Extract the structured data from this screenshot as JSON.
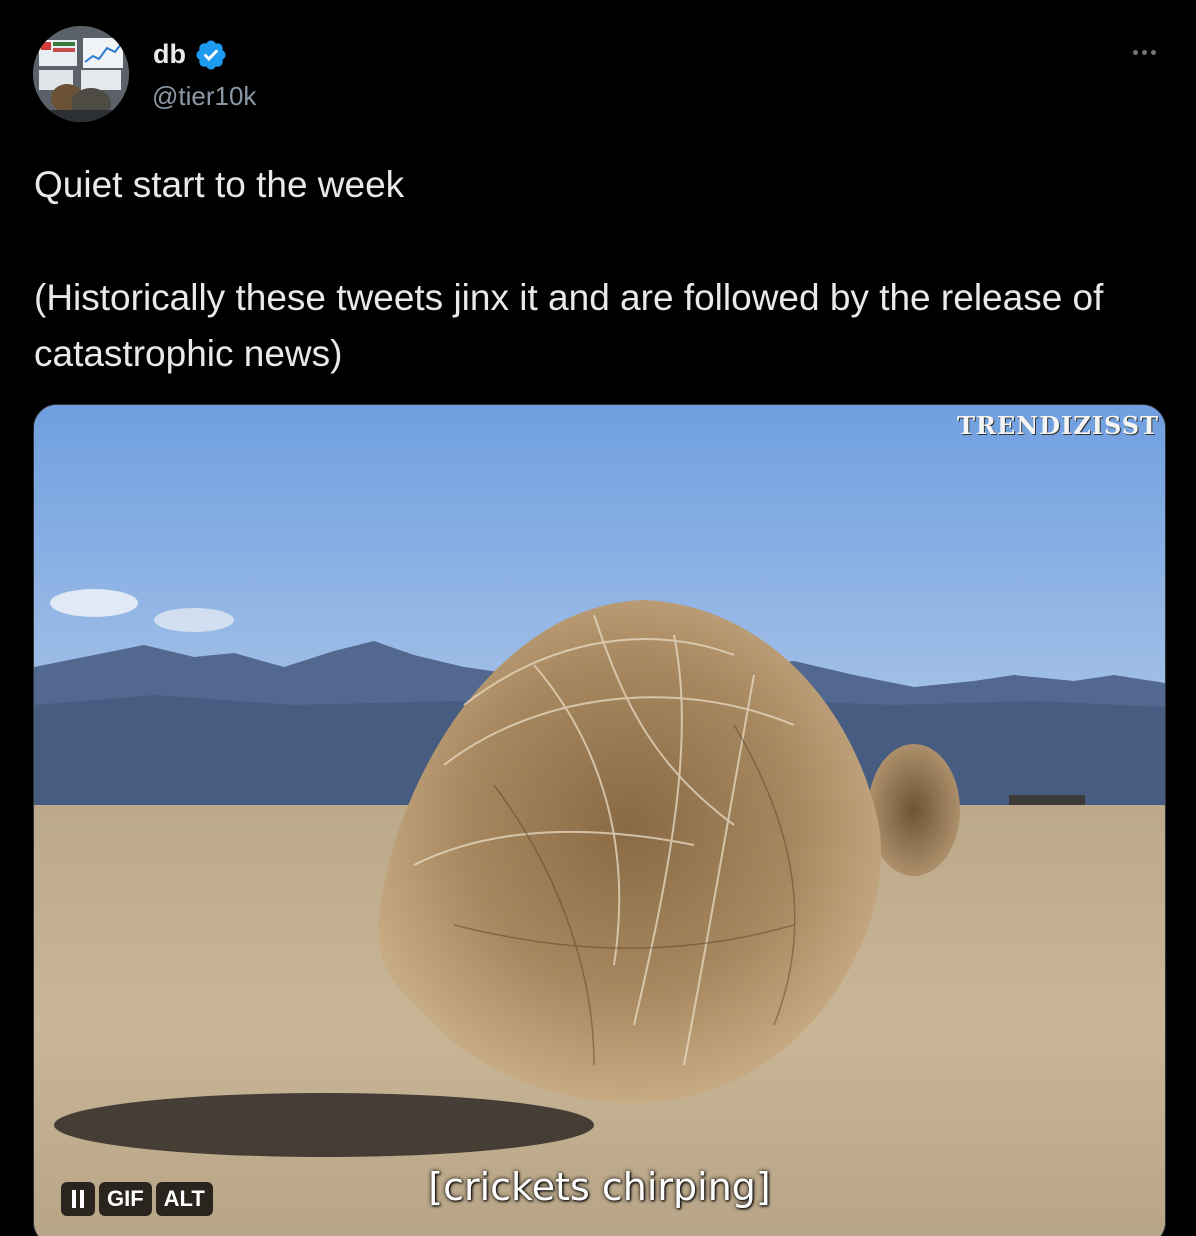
{
  "author": {
    "display_name": "db",
    "handle": "@tier10k",
    "verified": true,
    "avatar_icon": "avatar-photo"
  },
  "tweet": {
    "line1": "Quiet start to the week",
    "line2": "(Historically these tweets jinx it and are followed by the release of catastrophic news)"
  },
  "media": {
    "type": "GIF",
    "watermark": "TRENDIZISST",
    "caption": "[crickets chirping]",
    "pause_icon": "pause-icon",
    "gif_label": "GIF",
    "alt_label": "ALT"
  },
  "colors": {
    "background": "#000000",
    "text": "#e7e9ea",
    "secondary": "#8b98a5",
    "verified_blue": "#1d9bf0"
  }
}
